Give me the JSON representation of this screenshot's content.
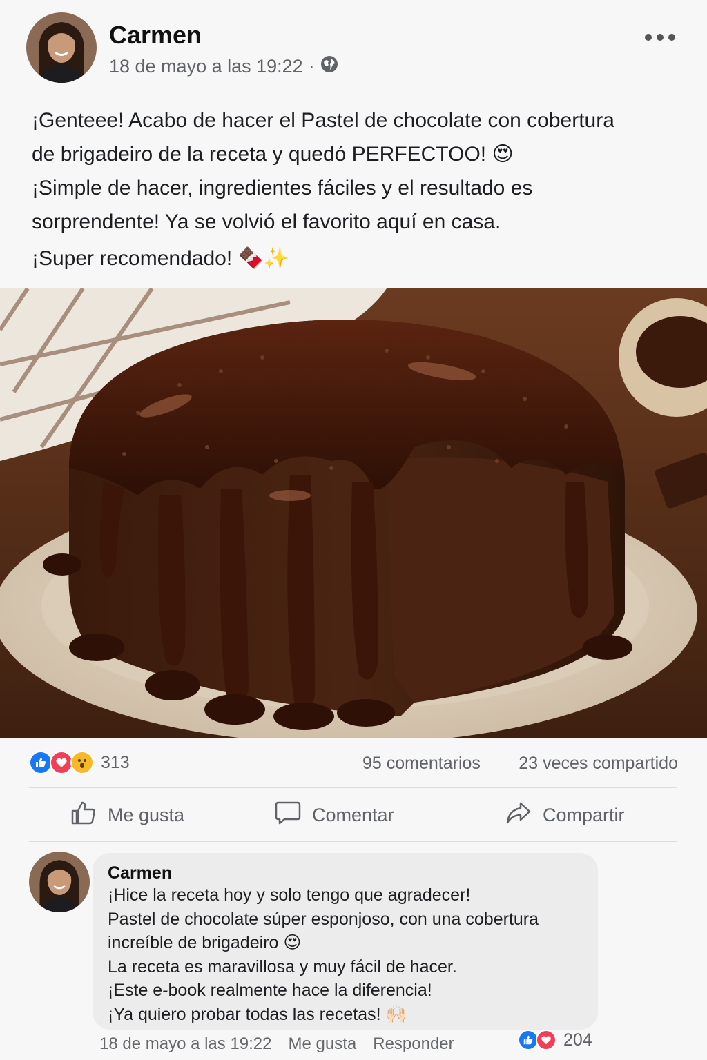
{
  "post": {
    "author": "Carmen",
    "timestamp": "18 de mayo a las 19:22",
    "separator": "·",
    "visibility_icon": "globe-icon",
    "text_lines": [
      "¡Genteee! Acabo de hacer el Pastel de chocolate con cobertura",
      "de brigadeiro de la receta y quedó PERFECTOO! 😍",
      "¡Simple de hacer, ingredientes fáciles y el resultado es",
      "sorprendente! Ya se volvió el favorito aquí en casa.",
      "¡Super recomendado! 🍫✨"
    ]
  },
  "stats": {
    "reaction_icons": [
      "like-icon",
      "love-icon",
      "wow-icon"
    ],
    "reactions_count": "313",
    "comments": "95 comentarios",
    "shares": "23 veces compartido"
  },
  "actions": {
    "like": "Me gusta",
    "comment": "Comentar",
    "share": "Compartir"
  },
  "comment": {
    "author": "Carmen",
    "lines": [
      "¡Hice la receta hoy y solo tengo que agradecer!",
      "Pastel de chocolate súper esponjoso, con una cobertura",
      "increíble de brigadeiro 😍",
      "La receta es maravillosa y muy fácil de hacer.",
      "¡Este e-book realmente hace la diferencia!",
      "¡Ya quiero probar todas las recetas! 🙌🏻"
    ],
    "timestamp": "18 de mayo a las 19:22",
    "like_label": "Me gusta",
    "reply_label": "Responder",
    "reactions_count": "204"
  },
  "colors": {
    "like_blue": "#1877f2",
    "love_red": "#f33e58",
    "wow_yellow": "#f7b928",
    "muted_text": "#5f6368"
  }
}
